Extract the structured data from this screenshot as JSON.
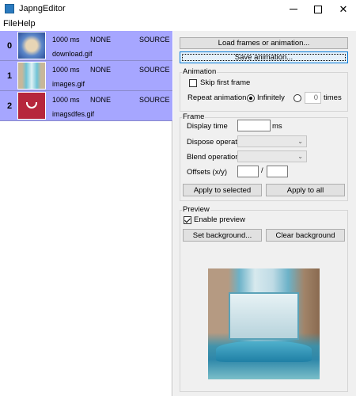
{
  "window": {
    "title": "JapngEditor",
    "icon": "app-icon"
  },
  "menu": [
    {
      "label": "File"
    },
    {
      "label": "Help"
    }
  ],
  "frames": [
    {
      "index": "0",
      "delay": "1000 ms",
      "dispose": "NONE",
      "blend": "SOURCE",
      "filename": "download.gif",
      "thumb": "sea-urchin-thumbnail"
    },
    {
      "index": "1",
      "delay": "1000 ms",
      "dispose": "NONE",
      "blend": "SOURCE",
      "filename": "images.gif",
      "thumb": "ocean-wave-thumbnail"
    },
    {
      "index": "2",
      "delay": "1000 ms",
      "dispose": "NONE",
      "blend": "SOURCE",
      "filename": "imagsdfes.gif",
      "thumb": "red-smile-thumbnail"
    }
  ],
  "buttons": {
    "load": "Load frames or animation...",
    "save": "Save animation...",
    "apply_selected": "Apply to selected",
    "apply_all": "Apply to all",
    "set_bg": "Set background...",
    "clear_bg": "Clear background"
  },
  "animation": {
    "title": "Animation",
    "skip_first": "Skip first frame",
    "skip_first_checked": false,
    "repeat_label": "Repeat animation",
    "infinitely_label": "Infinitely",
    "infinitely_selected": true,
    "times_value": "0",
    "times_label": "times"
  },
  "frame": {
    "title": "Frame",
    "display_time": "Display time",
    "ms": "ms",
    "dispose": "Dispose operation",
    "blend": "Blend operation",
    "offsets": "Offsets (x/y)",
    "slash": "/"
  },
  "preview": {
    "title": "Preview",
    "enable": "Enable preview",
    "enable_checked": true
  }
}
